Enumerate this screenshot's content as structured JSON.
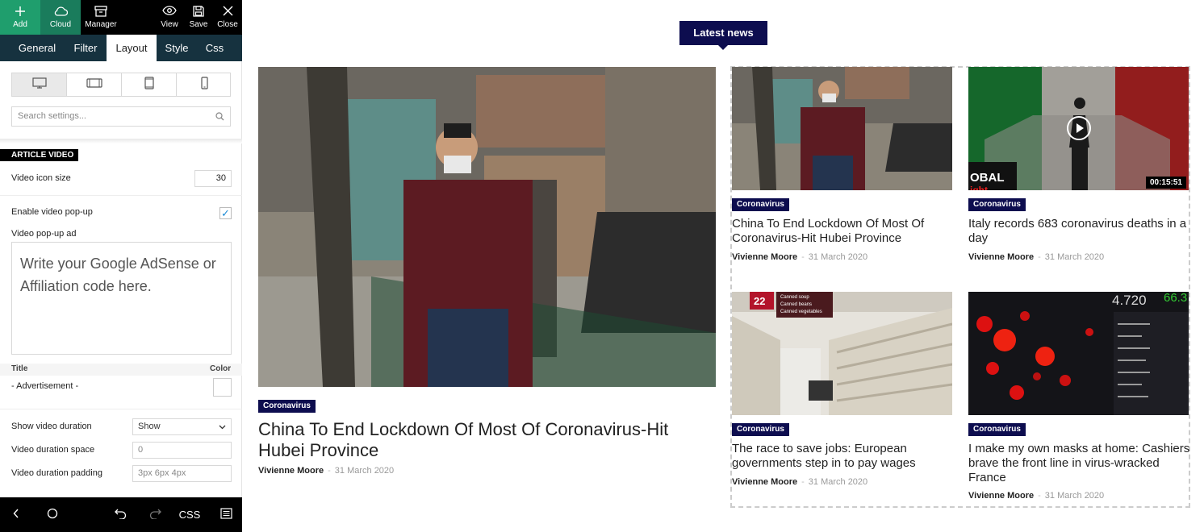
{
  "toolbar": {
    "add": "Add",
    "cloud": "Cloud",
    "manager": "Manager",
    "view": "View",
    "save": "Save",
    "close": "Close"
  },
  "tabs": [
    "General",
    "Filter",
    "Layout",
    "Style",
    "Css"
  ],
  "active_tab": "Layout",
  "search": {
    "placeholder": "Search settings..."
  },
  "section": {
    "title": "ARTICLE VIDEO"
  },
  "settings": {
    "video_icon_size_label": "Video icon size",
    "video_icon_size_value": "30",
    "enable_popup_label": "Enable video pop-up",
    "enable_popup_checked": true,
    "popup_ad_label": "Video pop-up ad",
    "popup_ad_placeholder": "Write your Google AdSense or Affiliation code here.",
    "title_label": "Title",
    "color_label": "Color",
    "title_value": "- Advertisement -",
    "show_duration_label": "Show video duration",
    "show_duration_value": "Show",
    "duration_space_label": "Video duration space",
    "duration_space_placeholder": "0",
    "duration_padding_label": "Video duration padding",
    "duration_padding_placeholder": "3px 6px 4px"
  },
  "bottombar": {
    "css": "CSS"
  },
  "block": {
    "title": "Latest news"
  },
  "featured": {
    "category": "Coronavirus",
    "title": "China To End Lockdown Of Most Of Coronavirus-Hit Hubei Province",
    "author": "Vivienne Moore",
    "date": "31 March 2020"
  },
  "articles": [
    {
      "category": "Coronavirus",
      "title": "China To End Lockdown Of Most Of Coronavirus-Hit Hubei Province",
      "author": "Vivienne Moore",
      "date": "31 March 2020"
    },
    {
      "category": "Coronavirus",
      "title": "Italy records 683 coronavirus deaths in a day",
      "author": "Vivienne Moore",
      "date": "31 March 2020",
      "duration": "00:15:51"
    },
    {
      "category": "Coronavirus",
      "title": "The race to save jobs: European governments step in to pay wages",
      "author": "Vivienne Moore",
      "date": "31 March 2020"
    },
    {
      "category": "Coronavirus",
      "title": "I make my own masks at home: Cashiers brave the front line in virus-wracked France",
      "author": "Vivienne Moore",
      "date": "31 March 2020"
    }
  ],
  "image_text": {
    "banner": "OBAL",
    "banner2": "ight",
    "shelf_number": "22",
    "shelf_sign1": "Canned soup",
    "shelf_sign2": "Canned beans",
    "shelf_sign3": "Canned vegetables",
    "map_number_left": "4.720",
    "map_number_right": "66.3"
  },
  "colors": {
    "accent_green": "#1f9e6d",
    "tab_bar": "#16323f",
    "category_badge": "#0d0d4f"
  }
}
